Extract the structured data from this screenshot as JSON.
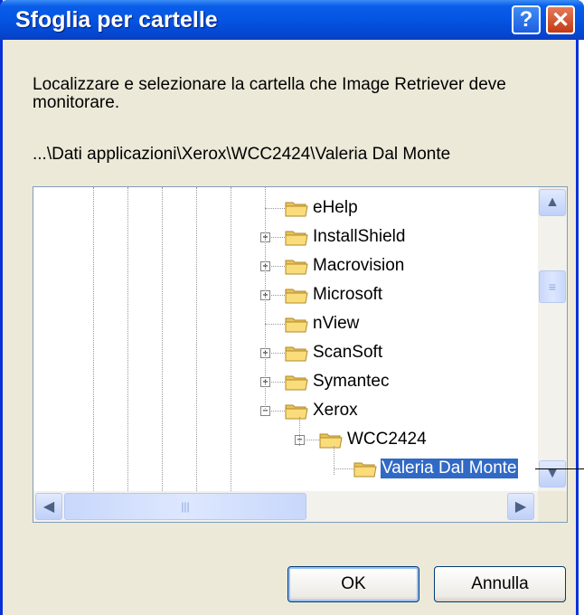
{
  "window": {
    "title": "Sfoglia per cartelle",
    "help_glyph": "?",
    "close_glyph": "✕"
  },
  "prompt": "Localizzare e selezionare la cartella che Image Retriever deve monitorare.",
  "current_path": "...\\Dati applicazioni\\Xerox\\WCC2424\\Valeria Dal Monte",
  "tree": {
    "items": [
      {
        "label": "eHelp",
        "expander": "none",
        "level": 0
      },
      {
        "label": "InstallShield",
        "expander": "+",
        "level": 0
      },
      {
        "label": "Macrovision",
        "expander": "+",
        "level": 0
      },
      {
        "label": "Microsoft",
        "expander": "+",
        "level": 0
      },
      {
        "label": "nView",
        "expander": "none",
        "level": 0
      },
      {
        "label": "ScanSoft",
        "expander": "+",
        "level": 0
      },
      {
        "label": "Symantec",
        "expander": "+",
        "level": 0
      },
      {
        "label": "Xerox",
        "expander": "-",
        "level": 0
      },
      {
        "label": "WCC2424",
        "expander": "-",
        "level": 1
      },
      {
        "label": "Valeria Dal Monte",
        "expander": "none",
        "level": 2,
        "selected": true
      }
    ]
  },
  "scroll_glyphs": {
    "up": "▲",
    "down": "▼",
    "left": "◀",
    "right": "▶",
    "grip": "≡"
  },
  "buttons": {
    "ok": "OK",
    "cancel": "Annulla"
  },
  "colors": {
    "title_bar": "#0554e3",
    "selection": "#316ac5",
    "dialog_bg": "#ece9d8"
  }
}
